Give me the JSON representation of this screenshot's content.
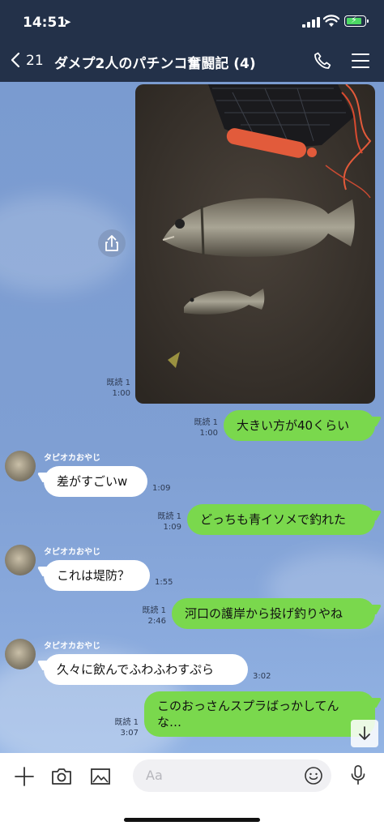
{
  "status": {
    "time": "14:51"
  },
  "header": {
    "back_count": "21",
    "title": "ダメプ2人のパチンコ奮闘記 (4)"
  },
  "messages": [
    {
      "type": "image",
      "read": "既読 1",
      "time": "1:00"
    },
    {
      "type": "sent",
      "text": "大きい方が40くらい",
      "read": "既読 1",
      "time": "1:00"
    },
    {
      "type": "received",
      "sender": "タピオカおやじ",
      "text": "差がすごいw",
      "time": "1:09"
    },
    {
      "type": "sent",
      "text": "どっちも青イソメで釣れた",
      "read": "既読 1",
      "time": "1:09"
    },
    {
      "type": "received",
      "sender": "タピオカおやじ",
      "text": "これは堤防？",
      "time": "1:55"
    },
    {
      "type": "sent",
      "text": "河口の護岸から投げ釣りやね",
      "read": "既読 1",
      "time": "2:46"
    },
    {
      "type": "received",
      "sender": "タピオカおやじ",
      "text": "久々に飲んでふわふわすぷら",
      "time": "3:02"
    },
    {
      "type": "sent",
      "text": "このおっさんスプラばっかしてんな…",
      "read": "既読 1",
      "time": "3:07"
    }
  ],
  "input": {
    "placeholder": "Aa"
  },
  "colors": {
    "header_bg": "#233149",
    "sent_bubble": "#7ad84d",
    "chat_bg": "#7f9fd3"
  },
  "icons": [
    "back-chevron-icon",
    "phone-icon",
    "menu-icon",
    "share-icon",
    "scroll-down-arrow-icon",
    "plus-icon",
    "camera-icon",
    "image-icon",
    "emoji-icon",
    "microphone-icon"
  ]
}
